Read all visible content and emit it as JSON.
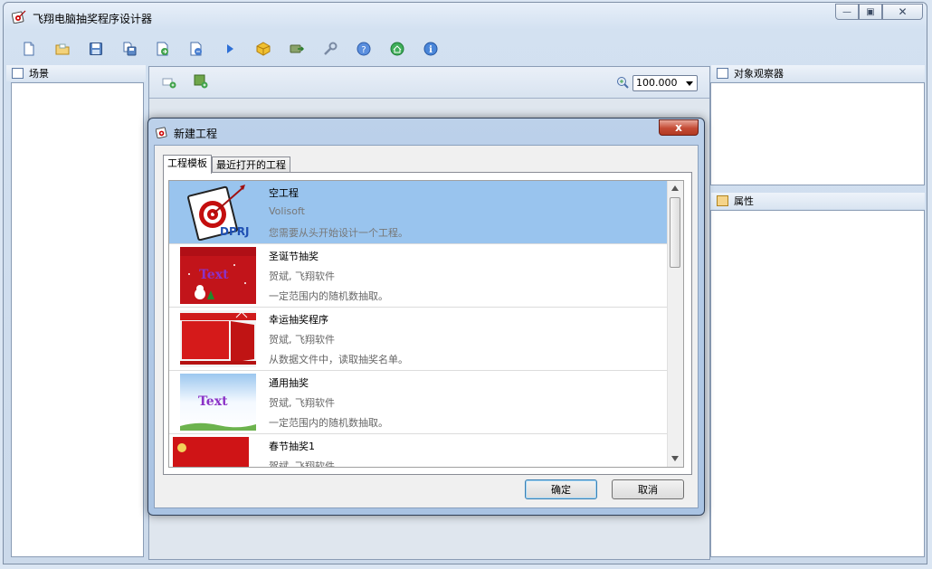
{
  "window": {
    "title": "飞翔电脑抽奖程序设计器",
    "caption": {
      "minimize": "—",
      "maximize": "▣",
      "close": "✕"
    }
  },
  "toolbar": {
    "icons": [
      "new-icon",
      "open-icon",
      "save-icon",
      "save-as-icon",
      "import-icon",
      "export-icon",
      "run-icon",
      "package-icon",
      "publish-icon",
      "settings-wrench-icon",
      "help-icon",
      "home-icon",
      "info-icon"
    ]
  },
  "panels": {
    "scene": {
      "title": "场景"
    },
    "object_browser": {
      "title": "对象观察器"
    },
    "properties": {
      "title": "属性"
    }
  },
  "center": {
    "zoom_value": "100.000"
  },
  "dialog": {
    "title": "新建工程",
    "close": "x",
    "tabs": [
      {
        "label": "工程模板",
        "active": true
      },
      {
        "label": "最近打开的工程",
        "active": false
      }
    ],
    "items": [
      {
        "name": "空工程",
        "author": "Volisoft",
        "description": "您需要从头开始设计一个工程。",
        "thumb_label": "DPRJ"
      },
      {
        "name": "圣诞节抽奖",
        "author": "贺斌, 飞翔软件",
        "description": "一定范围内的随机数抽取。",
        "thumb_label": "Text"
      },
      {
        "name": "幸运抽奖程序",
        "author": "贺斌, 飞翔软件",
        "description": "从数据文件中，读取抽奖名单。",
        "thumb_label": ""
      },
      {
        "name": "通用抽奖",
        "author": "贺斌, 飞翔软件",
        "description": "一定范围内的随机数抽取。",
        "thumb_label": "Text"
      },
      {
        "name": "春节抽奖1",
        "author": "贺斌, 飞翔软件",
        "description": "",
        "thumb_label": ""
      }
    ],
    "ok_label": "确定",
    "cancel_label": "取消"
  },
  "colors": {
    "selection": "#99c4ee",
    "window_frame": "#cbd9ea",
    "dialog_frame": "#a9c3e3"
  }
}
